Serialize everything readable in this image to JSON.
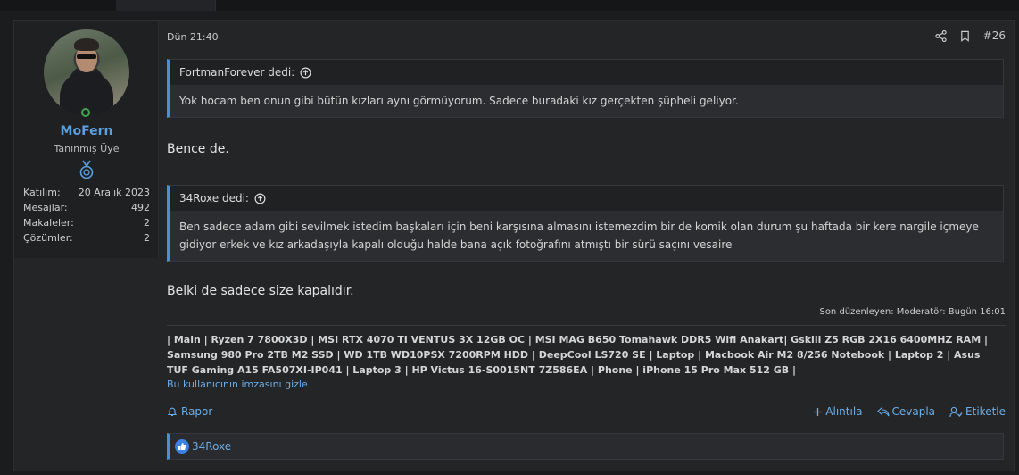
{
  "user": {
    "name": "MoFern",
    "title": "Tanınmış Üye",
    "stats": [
      {
        "label": "Katılım:",
        "value": "20 Aralık 2023"
      },
      {
        "label": "Mesajlar:",
        "value": "492"
      },
      {
        "label": "Makaleler:",
        "value": "2"
      },
      {
        "label": "Çözümler:",
        "value": "2"
      }
    ]
  },
  "post": {
    "date": "Dün 21:40",
    "number": "#26",
    "quotes": [
      {
        "author": "FortmanForever dedi:",
        "text": "Yok hocam ben onun gibi bütün kızları aynı görmüyorum. Sadece buradaki kız gerçekten şüpheli geliyor."
      },
      {
        "author": "34Roxe dedi:",
        "text": "Ben sadece adam gibi sevilmek istedim başkaları için beni karşısına almasını istemezdim bir de komik olan durum şu haftada bir kere nargile içmeye gidiyor erkek ve kız arkadaşıyla kapalı olduğu halde bana açık fotoğrafını atmıştı bir sürü saçını vesaire"
      }
    ],
    "text1": "Bence de.",
    "text2": "Belki de sadece size kapalıdır.",
    "edited": "Son düzenleyen: Moderatör: Bugün 16:01",
    "signature": "| Main | Ryzen 7 7800X3D | MSI RTX 4070 TI VENTUS 3X 12GB OC | MSI MAG B650 Tomahawk DDR5 Wifi Anakart| Gskill Z5 RGB 2X16 6400MHZ RAM | Samsung 980 Pro 2TB M2 SSD | WD 1TB WD10PSX 7200RPM HDD | DeepCool LS720 SE | Laptop | Macbook Air M2 8/256 Notebook | Laptop 2 | Asus TUF Gaming A15 FA507XI-IP041 | Laptop 3 | HP Victus 16-S0015NT 7Z586EA | Phone | iPhone 15 Pro Max 512 GB |",
    "sig_toggle": "Bu kullanıcının imzasını gizle",
    "report": "Rapor",
    "quote_action": "Alıntıla",
    "reply_action": "Cevapla",
    "tag_action": "Etiketle",
    "reaction_user": "34Roxe"
  }
}
